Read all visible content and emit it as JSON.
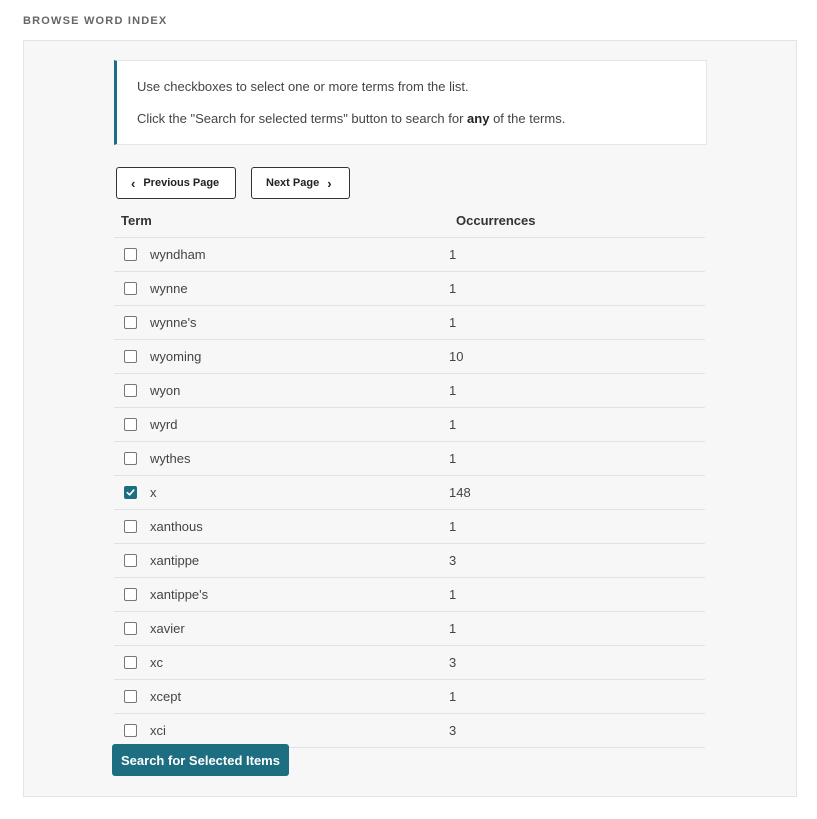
{
  "header": {
    "title": "BROWSE WORD INDEX"
  },
  "info": {
    "line1": "Use checkboxes to select one or more terms from the list.",
    "line2_pre": "Click the \"Search for selected terms\" button to search for ",
    "line2_bold": "any",
    "line2_post": " of the terms."
  },
  "pager": {
    "previous_label": "Previous Page",
    "next_label": "Next Page"
  },
  "table": {
    "columns": [
      "Term",
      "Occurrences"
    ],
    "rows": [
      {
        "term": "wyndham",
        "count": "1",
        "checked": false
      },
      {
        "term": "wynne",
        "count": "1",
        "checked": false
      },
      {
        "term": "wynne's",
        "count": "1",
        "checked": false
      },
      {
        "term": "wyoming",
        "count": "10",
        "checked": false
      },
      {
        "term": "wyon",
        "count": "1",
        "checked": false
      },
      {
        "term": "wyrd",
        "count": "1",
        "checked": false
      },
      {
        "term": "wythes",
        "count": "1",
        "checked": false
      },
      {
        "term": "x",
        "count": "148",
        "checked": true
      },
      {
        "term": "xanthous",
        "count": "1",
        "checked": false
      },
      {
        "term": "xantippe",
        "count": "3",
        "checked": false
      },
      {
        "term": "xantippe's",
        "count": "1",
        "checked": false
      },
      {
        "term": "xavier",
        "count": "1",
        "checked": false
      },
      {
        "term": "xc",
        "count": "3",
        "checked": false
      },
      {
        "term": "xcept",
        "count": "1",
        "checked": false
      },
      {
        "term": "xci",
        "count": "3",
        "checked": false
      }
    ]
  },
  "actions": {
    "search_label": "Search for Selected Items"
  },
  "colors": {
    "accent": "#1e6e82"
  }
}
